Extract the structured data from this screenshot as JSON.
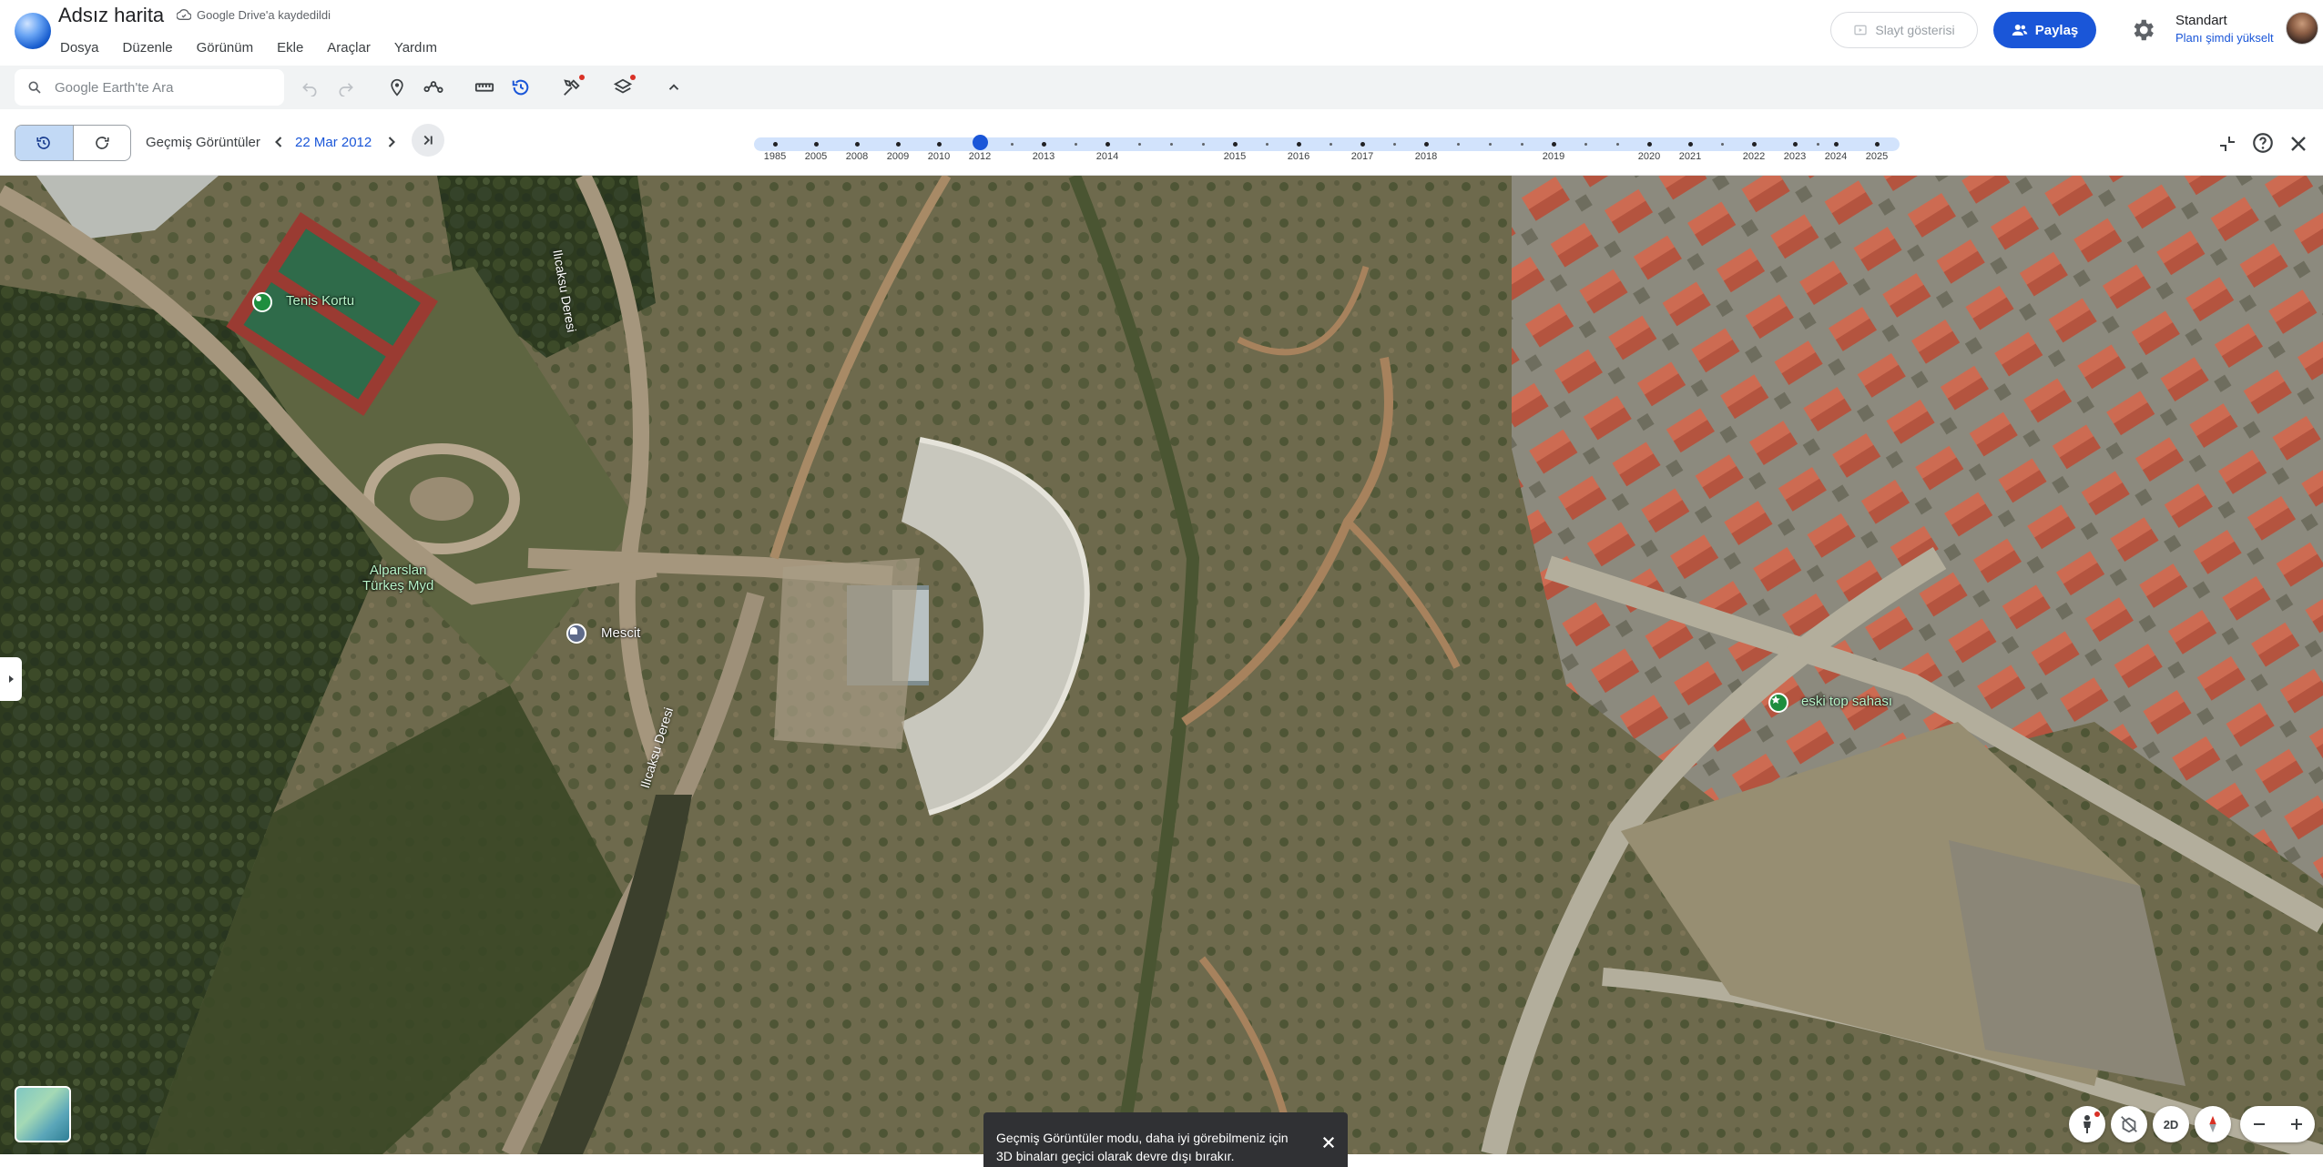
{
  "header": {
    "title": "Adsız harita",
    "save_status": "Google Drive'a kaydedildi",
    "menu": [
      "Dosya",
      "Düzenle",
      "Görünüm",
      "Ekle",
      "Araçlar",
      "Yardım"
    ],
    "slideshow_label": "Slayt gösterisi",
    "share_label": "Paylaş",
    "plan_name": "Standart",
    "plan_upgrade": "Planı şimdi yükselt"
  },
  "toolbar": {
    "search_placeholder": "Google Earth'te Ara",
    "icons": [
      "undo-icon",
      "redo-icon",
      "add-placemark-icon",
      "add-path-icon",
      "measure-icon",
      "historical-imagery-icon",
      "tools-icon",
      "layers-icon",
      "collapse-icon"
    ]
  },
  "historical": {
    "label": "Geçmiş Görüntüler",
    "current_date": "22 Mar 2012",
    "timeline_years": [
      "1985",
      "2005",
      "2008",
      "2009",
      "2010",
      "2012",
      "2013",
      "2014",
      "2015",
      "2016",
      "2017",
      "2018",
      "2019",
      "2020",
      "2021",
      "2022",
      "2023",
      "2024",
      "2025"
    ],
    "selected_year": "2012"
  },
  "map": {
    "labels": {
      "tennis": "Tenis Kortu",
      "park_line1": "Alparslan",
      "park_line2": "Türkeş Myd",
      "mescit": "Mescit",
      "river_top": "Ilıcaksu Deresi",
      "river_bottom": "Ilıcaksu Deresi",
      "field": "eski top sahası"
    },
    "toast": {
      "line1": "Geçmiş Görüntüler modu, daha iyi görebilmeniz için",
      "line2": "3D binaları geçici olarak devre dışı bırakır."
    },
    "controls": {
      "view_2d": "2D"
    }
  },
  "colors": {
    "accent": "#1a56d8",
    "timeline_track": "#d2e3fc",
    "toolbar_bg": "#f1f3f4"
  }
}
